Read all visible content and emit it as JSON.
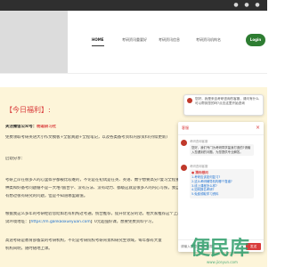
{
  "topbar": {
    "icons": [
      "wechat-icon",
      "weibo-icon",
      "qq-icon"
    ]
  },
  "header": {
    "nav": [
      {
        "label": "HOME",
        "active": true
      },
      {
        "label": "考研资讯重要好"
      },
      {
        "label": "考研资讯信息"
      },
      {
        "label": "考研资讯机构名"
      }
    ],
    "login_label": "Login"
  },
  "article": {
    "title": "【今日福利】:",
    "p1_prefix": "关注微信公众号：",
    "p1_highlight": "杨逗研习社",
    "p2": "免费领取考研英语大小作文模板+全套真题+全程笔记，以及各类备考资料内部资料(持续更新)",
    "p3": "启幼分享：",
    "p4": "考研上岸在很多人的心里似乎都被比较难的，不论是在初试是在英、英语、数学想要高分?复习全程重拾一种思维的很多实录或者",
    "p5": "种类和好备考问题循不是一大堆?圆台学、没有方法、没有动力、都级这就是很多人的内心写照，我自己也曾经这样过，后来",
    "p6": "有想过很有研究的问题，但是不知道哪里最值。",
    "p7_prefix": "根据我这么多年的考研经验总结如若有机构过考通，统合推荐，提升优化分的话，相大家推荐这个上岸课堂就会去发，",
    "p8_prefix": "试环境地址：【",
    "p8_link": "https://m.gankaoxueyuan.com",
    "p8_suffix": "】0元超强好课，想要免费资料学习，",
    "p9": "高途考研是教育部备案的考研机构，不论是考研院校考研背景和研究生领域，每年都有大量",
    "p10": "机构间明，随时随地上课。"
  },
  "bubble": {
    "text": "您好，我是来自考研咨询的客服，请问有什么可以帮到您的吗?点击这里开始咨询"
  },
  "chat": {
    "title": "客服",
    "agent_name": "考研咨询客服",
    "greeting": "您好，我们专门为考研同学量身打造的?请输入您遇到的问题，为您提供专业解答。",
    "faq_title": "● 猜你想问",
    "faq": [
      "1.考研应该如何复习?",
      "2.这么考研辅导机构哪个靠谱?",
      "3.线上课程怎么样?",
      "4.如何报名考研?",
      "5.免费领取学习资料"
    ],
    "input_placeholder": "请输入您想咨询的问题",
    "send_label": "发送"
  },
  "watermark": {
    "text": "便民库",
    "sub": "www.jiceyun.com"
  }
}
